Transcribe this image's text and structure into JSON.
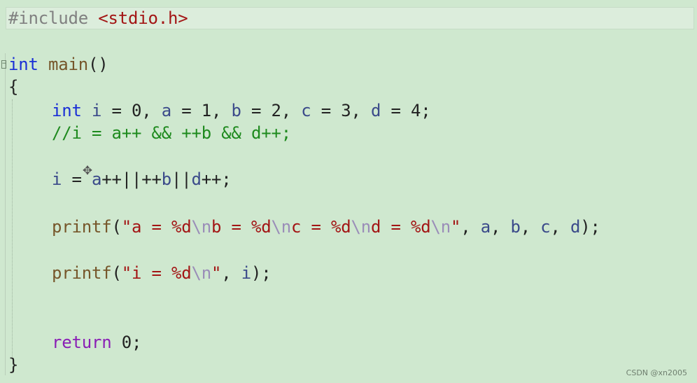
{
  "editor": {
    "lines": {
      "l1": {
        "directive": "#include",
        "header": "<stdio.h>"
      },
      "l3": {
        "type": "int",
        "name": "main",
        "parens": "()"
      },
      "l4": {
        "brace": "{"
      },
      "l5": {
        "type": "int",
        "i": "i",
        "a": "a",
        "b": "b",
        "c": "c",
        "d": "d",
        "eq": " = ",
        "comma": ", ",
        "v0": "0",
        "v1": "1",
        "v2": "2",
        "v3": "3",
        "v4": "4",
        "semi": ";"
      },
      "l6": {
        "comment": "//i = a++ && ++b && d++;"
      },
      "l8": {
        "i": "i",
        "eq": " = ",
        "a": "a",
        "pp1": "++||++",
        "b": "b",
        "or": "||",
        "d": "d",
        "pp2": "++;"
      },
      "l10": {
        "fn": "printf",
        "open": "(",
        "q1": "\"a = %d",
        "e1": "\\n",
        "s2": "b = %d",
        "e2": "\\n",
        "s3": "c = %d",
        "e3": "\\n",
        "s4": "d = %d",
        "e4": "\\n",
        "q2": "\"",
        "sep": ", ",
        "a": "a",
        "b": "b",
        "c": "c",
        "d": "d",
        "close": ");"
      },
      "l12": {
        "fn": "printf",
        "open": "(",
        "q1": "\"i = %d",
        "e1": "\\n",
        "q2": "\"",
        "sep": ", ",
        "i": "i",
        "close": ");"
      },
      "l15": {
        "kw": "return",
        "val": "0",
        "semi": ";"
      },
      "l16": {
        "brace": "}"
      }
    },
    "cursor_icon": "move-cursor-icon"
  },
  "watermark": "CSDN @xn2005",
  "colors": {
    "background": "#cfe8cf",
    "keyword": "#1a2fd6",
    "return_keyword": "#8a1fb5",
    "string": "#a31515",
    "comment": "#1e8a1e",
    "variable": "#3b4a8a"
  }
}
